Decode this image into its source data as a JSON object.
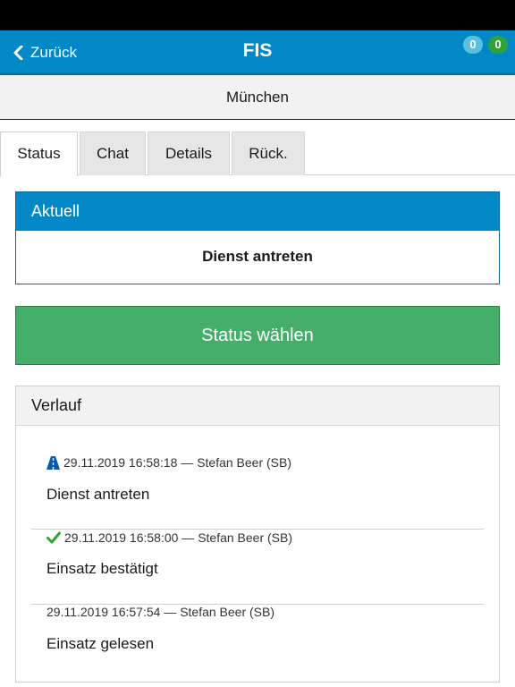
{
  "appbar": {
    "back_label": "Zurück",
    "title": "FIS",
    "badge_blue": "0",
    "badge_green": "0",
    "color": "#0288c7"
  },
  "subheader": {
    "title": "München"
  },
  "tabs": [
    {
      "label": "Status",
      "active": true
    },
    {
      "label": "Chat",
      "active": false
    },
    {
      "label": "Details",
      "active": false
    },
    {
      "label": "Rück.",
      "active": false
    }
  ],
  "current": {
    "heading": "Aktuell",
    "value": "Dienst antreten"
  },
  "select_button": {
    "label": "Status wählen",
    "color": "#45ae68"
  },
  "history": {
    "heading": "Verlauf",
    "entries": [
      {
        "icon": "road-icon",
        "meta": "29.11.2019 16:58:18 — Stefan Beer (SB)",
        "status": "Dienst antreten"
      },
      {
        "icon": "checkmark-icon",
        "meta": "29.11.2019 16:58:00 — Stefan Beer (SB)",
        "status": "Einsatz bestätigt"
      },
      {
        "icon": "",
        "meta": "29.11.2019 16:57:54 — Stefan Beer (SB)",
        "status": "Einsatz gelesen"
      }
    ]
  }
}
